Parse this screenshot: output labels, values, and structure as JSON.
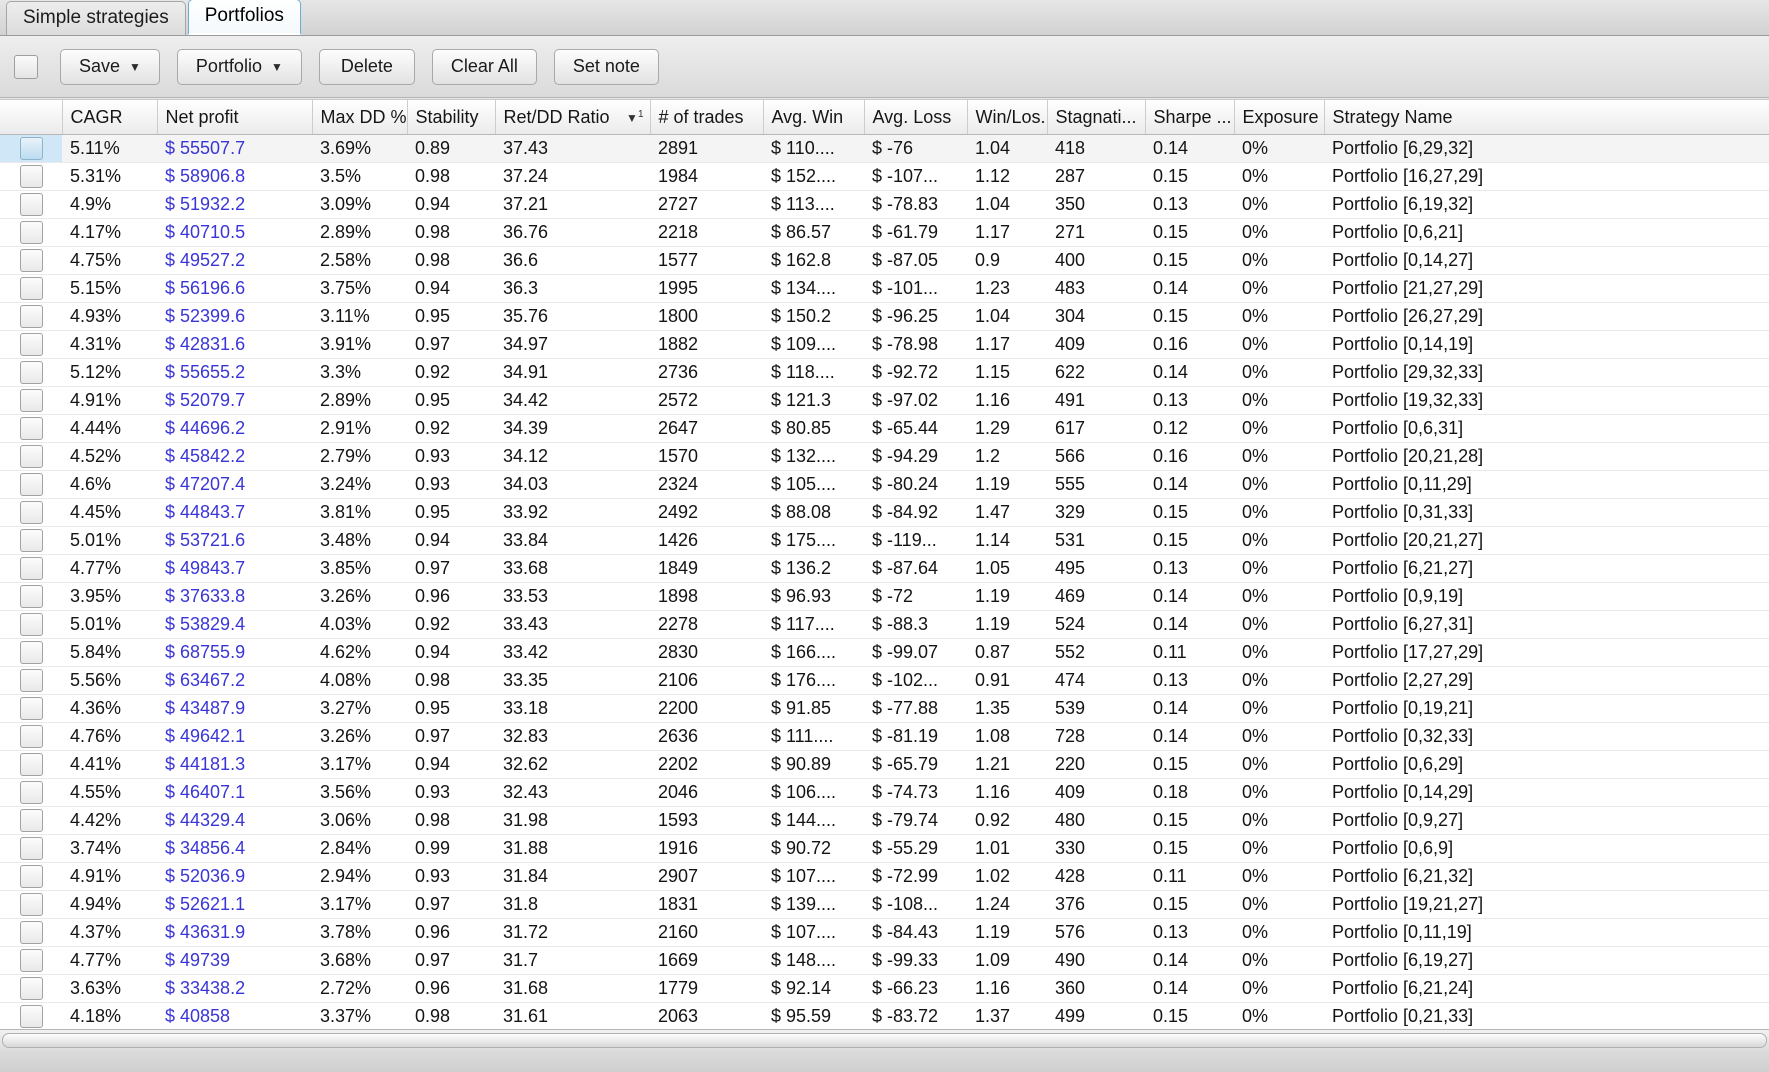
{
  "tabs": [
    {
      "label": "Simple strategies",
      "active": false
    },
    {
      "label": "Portfolios",
      "active": true
    }
  ],
  "toolbar": {
    "select_all_checkbox": "",
    "buttons": [
      {
        "label": "Save",
        "caret": "▼"
      },
      {
        "label": "Portfolio",
        "caret": "▼"
      },
      {
        "label": "Delete",
        "caret": ""
      },
      {
        "label": "Clear All",
        "caret": ""
      },
      {
        "label": "Set note",
        "caret": ""
      }
    ]
  },
  "table": {
    "sort": {
      "column": "Ret/DD Ratio",
      "direction": "▼",
      "priority": "1"
    },
    "columns": [
      {
        "key": "checkbox",
        "label": ""
      },
      {
        "key": "cagr",
        "label": "CAGR"
      },
      {
        "key": "net",
        "label": "Net profit"
      },
      {
        "key": "maxdd",
        "label": "Max DD %"
      },
      {
        "key": "stability",
        "label": "Stability"
      },
      {
        "key": "retdd",
        "label": "Ret/DD Ratio"
      },
      {
        "key": "trades",
        "label": "# of trades"
      },
      {
        "key": "avgwin",
        "label": "Avg. Win"
      },
      {
        "key": "avgloss",
        "label": "Avg. Loss"
      },
      {
        "key": "winloss",
        "label": "Win/Los..."
      },
      {
        "key": "stagnation",
        "label": "Stagnati..."
      },
      {
        "key": "sharpe",
        "label": "Sharpe ..."
      },
      {
        "key": "exposure",
        "label": "Exposure"
      },
      {
        "key": "name",
        "label": "Strategy Name"
      }
    ],
    "rows": [
      {
        "selected": true,
        "cagr": "5.11%",
        "net": "$ 55507.7",
        "maxdd": "3.69%",
        "stability": "0.89",
        "retdd": "37.43",
        "trades": "2891",
        "avgwin": "$ 110....",
        "avgloss": "$ -76",
        "winloss": "1.04",
        "stagnation": "418",
        "sharpe": "0.14",
        "exposure": "0%",
        "name": "Portfolio [6,29,32]"
      },
      {
        "selected": false,
        "cagr": "5.31%",
        "net": "$ 58906.8",
        "maxdd": "3.5%",
        "stability": "0.98",
        "retdd": "37.24",
        "trades": "1984",
        "avgwin": "$ 152....",
        "avgloss": "$ -107...",
        "winloss": "1.12",
        "stagnation": "287",
        "sharpe": "0.15",
        "exposure": "0%",
        "name": "Portfolio [16,27,29]"
      },
      {
        "selected": false,
        "cagr": "4.9%",
        "net": "$ 51932.2",
        "maxdd": "3.09%",
        "stability": "0.94",
        "retdd": "37.21",
        "trades": "2727",
        "avgwin": "$ 113....",
        "avgloss": "$ -78.83",
        "winloss": "1.04",
        "stagnation": "350",
        "sharpe": "0.13",
        "exposure": "0%",
        "name": "Portfolio [6,19,32]"
      },
      {
        "selected": false,
        "cagr": "4.17%",
        "net": "$ 40710.5",
        "maxdd": "2.89%",
        "stability": "0.98",
        "retdd": "36.76",
        "trades": "2218",
        "avgwin": "$ 86.57",
        "avgloss": "$ -61.79",
        "winloss": "1.17",
        "stagnation": "271",
        "sharpe": "0.15",
        "exposure": "0%",
        "name": "Portfolio [0,6,21]"
      },
      {
        "selected": false,
        "cagr": "4.75%",
        "net": "$ 49527.2",
        "maxdd": "2.58%",
        "stability": "0.98",
        "retdd": "36.6",
        "trades": "1577",
        "avgwin": "$ 162.8",
        "avgloss": "$ -87.05",
        "winloss": "0.9",
        "stagnation": "400",
        "sharpe": "0.15",
        "exposure": "0%",
        "name": "Portfolio [0,14,27]"
      },
      {
        "selected": false,
        "cagr": "5.15%",
        "net": "$ 56196.6",
        "maxdd": "3.75%",
        "stability": "0.94",
        "retdd": "36.3",
        "trades": "1995",
        "avgwin": "$ 134....",
        "avgloss": "$ -101...",
        "winloss": "1.23",
        "stagnation": "483",
        "sharpe": "0.14",
        "exposure": "0%",
        "name": "Portfolio [21,27,29]"
      },
      {
        "selected": false,
        "cagr": "4.93%",
        "net": "$ 52399.6",
        "maxdd": "3.11%",
        "stability": "0.95",
        "retdd": "35.76",
        "trades": "1800",
        "avgwin": "$ 150.2",
        "avgloss": "$ -96.25",
        "winloss": "1.04",
        "stagnation": "304",
        "sharpe": "0.15",
        "exposure": "0%",
        "name": "Portfolio [26,27,29]"
      },
      {
        "selected": false,
        "cagr": "4.31%",
        "net": "$ 42831.6",
        "maxdd": "3.91%",
        "stability": "0.97",
        "retdd": "34.97",
        "trades": "1882",
        "avgwin": "$ 109....",
        "avgloss": "$ -78.98",
        "winloss": "1.17",
        "stagnation": "409",
        "sharpe": "0.16",
        "exposure": "0%",
        "name": "Portfolio [0,14,19]"
      },
      {
        "selected": false,
        "cagr": "5.12%",
        "net": "$ 55655.2",
        "maxdd": "3.3%",
        "stability": "0.92",
        "retdd": "34.91",
        "trades": "2736",
        "avgwin": "$ 118....",
        "avgloss": "$ -92.72",
        "winloss": "1.15",
        "stagnation": "622",
        "sharpe": "0.14",
        "exposure": "0%",
        "name": "Portfolio [29,32,33]"
      },
      {
        "selected": false,
        "cagr": "4.91%",
        "net": "$ 52079.7",
        "maxdd": "2.89%",
        "stability": "0.95",
        "retdd": "34.42",
        "trades": "2572",
        "avgwin": "$ 121.3",
        "avgloss": "$ -97.02",
        "winloss": "1.16",
        "stagnation": "491",
        "sharpe": "0.13",
        "exposure": "0%",
        "name": "Portfolio [19,32,33]"
      },
      {
        "selected": false,
        "cagr": "4.44%",
        "net": "$ 44696.2",
        "maxdd": "2.91%",
        "stability": "0.92",
        "retdd": "34.39",
        "trades": "2647",
        "avgwin": "$ 80.85",
        "avgloss": "$ -65.44",
        "winloss": "1.29",
        "stagnation": "617",
        "sharpe": "0.12",
        "exposure": "0%",
        "name": "Portfolio [0,6,31]"
      },
      {
        "selected": false,
        "cagr": "4.52%",
        "net": "$ 45842.2",
        "maxdd": "2.79%",
        "stability": "0.93",
        "retdd": "34.12",
        "trades": "1570",
        "avgwin": "$ 132....",
        "avgloss": "$ -94.29",
        "winloss": "1.2",
        "stagnation": "566",
        "sharpe": "0.16",
        "exposure": "0%",
        "name": "Portfolio [20,21,28]"
      },
      {
        "selected": false,
        "cagr": "4.6%",
        "net": "$ 47207.4",
        "maxdd": "3.24%",
        "stability": "0.93",
        "retdd": "34.03",
        "trades": "2324",
        "avgwin": "$ 105....",
        "avgloss": "$ -80.24",
        "winloss": "1.19",
        "stagnation": "555",
        "sharpe": "0.14",
        "exposure": "0%",
        "name": "Portfolio [0,11,29]"
      },
      {
        "selected": false,
        "cagr": "4.45%",
        "net": "$ 44843.7",
        "maxdd": "3.81%",
        "stability": "0.95",
        "retdd": "33.92",
        "trades": "2492",
        "avgwin": "$ 88.08",
        "avgloss": "$ -84.92",
        "winloss": "1.47",
        "stagnation": "329",
        "sharpe": "0.15",
        "exposure": "0%",
        "name": "Portfolio [0,31,33]"
      },
      {
        "selected": false,
        "cagr": "5.01%",
        "net": "$ 53721.6",
        "maxdd": "3.48%",
        "stability": "0.94",
        "retdd": "33.84",
        "trades": "1426",
        "avgwin": "$ 175....",
        "avgloss": "$ -119...",
        "winloss": "1.14",
        "stagnation": "531",
        "sharpe": "0.15",
        "exposure": "0%",
        "name": "Portfolio [20,21,27]"
      },
      {
        "selected": false,
        "cagr": "4.77%",
        "net": "$ 49843.7",
        "maxdd": "3.85%",
        "stability": "0.97",
        "retdd": "33.68",
        "trades": "1849",
        "avgwin": "$ 136.2",
        "avgloss": "$ -87.64",
        "winloss": "1.05",
        "stagnation": "495",
        "sharpe": "0.13",
        "exposure": "0%",
        "name": "Portfolio [6,21,27]"
      },
      {
        "selected": false,
        "cagr": "3.95%",
        "net": "$ 37633.8",
        "maxdd": "3.26%",
        "stability": "0.96",
        "retdd": "33.53",
        "trades": "1898",
        "avgwin": "$ 96.93",
        "avgloss": "$ -72",
        "winloss": "1.19",
        "stagnation": "469",
        "sharpe": "0.14",
        "exposure": "0%",
        "name": "Portfolio [0,9,19]"
      },
      {
        "selected": false,
        "cagr": "5.01%",
        "net": "$ 53829.4",
        "maxdd": "4.03%",
        "stability": "0.92",
        "retdd": "33.43",
        "trades": "2278",
        "avgwin": "$ 117....",
        "avgloss": "$ -88.3",
        "winloss": "1.19",
        "stagnation": "524",
        "sharpe": "0.14",
        "exposure": "0%",
        "name": "Portfolio [6,27,31]"
      },
      {
        "selected": false,
        "cagr": "5.84%",
        "net": "$ 68755.9",
        "maxdd": "4.62%",
        "stability": "0.94",
        "retdd": "33.42",
        "trades": "2830",
        "avgwin": "$ 166....",
        "avgloss": "$ -99.07",
        "winloss": "0.87",
        "stagnation": "552",
        "sharpe": "0.11",
        "exposure": "0%",
        "name": "Portfolio [17,27,29]"
      },
      {
        "selected": false,
        "cagr": "5.56%",
        "net": "$ 63467.2",
        "maxdd": "4.08%",
        "stability": "0.98",
        "retdd": "33.35",
        "trades": "2106",
        "avgwin": "$ 176....",
        "avgloss": "$ -102...",
        "winloss": "0.91",
        "stagnation": "474",
        "sharpe": "0.13",
        "exposure": "0%",
        "name": "Portfolio [2,27,29]"
      },
      {
        "selected": false,
        "cagr": "4.36%",
        "net": "$ 43487.9",
        "maxdd": "3.27%",
        "stability": "0.95",
        "retdd": "33.18",
        "trades": "2200",
        "avgwin": "$ 91.85",
        "avgloss": "$ -77.88",
        "winloss": "1.35",
        "stagnation": "539",
        "sharpe": "0.14",
        "exposure": "0%",
        "name": "Portfolio [0,19,21]"
      },
      {
        "selected": false,
        "cagr": "4.76%",
        "net": "$ 49642.1",
        "maxdd": "3.26%",
        "stability": "0.97",
        "retdd": "32.83",
        "trades": "2636",
        "avgwin": "$ 111....",
        "avgloss": "$ -81.19",
        "winloss": "1.08",
        "stagnation": "728",
        "sharpe": "0.14",
        "exposure": "0%",
        "name": "Portfolio [0,32,33]"
      },
      {
        "selected": false,
        "cagr": "4.41%",
        "net": "$ 44181.3",
        "maxdd": "3.17%",
        "stability": "0.94",
        "retdd": "32.62",
        "trades": "2202",
        "avgwin": "$ 90.89",
        "avgloss": "$ -65.79",
        "winloss": "1.21",
        "stagnation": "220",
        "sharpe": "0.15",
        "exposure": "0%",
        "name": "Portfolio [0,6,29]"
      },
      {
        "selected": false,
        "cagr": "4.55%",
        "net": "$ 46407.1",
        "maxdd": "3.56%",
        "stability": "0.93",
        "retdd": "32.43",
        "trades": "2046",
        "avgwin": "$ 106....",
        "avgloss": "$ -74.73",
        "winloss": "1.16",
        "stagnation": "409",
        "sharpe": "0.18",
        "exposure": "0%",
        "name": "Portfolio [0,14,29]"
      },
      {
        "selected": false,
        "cagr": "4.42%",
        "net": "$ 44329.4",
        "maxdd": "3.06%",
        "stability": "0.98",
        "retdd": "31.98",
        "trades": "1593",
        "avgwin": "$ 144....",
        "avgloss": "$ -79.74",
        "winloss": "0.92",
        "stagnation": "480",
        "sharpe": "0.15",
        "exposure": "0%",
        "name": "Portfolio [0,9,27]"
      },
      {
        "selected": false,
        "cagr": "3.74%",
        "net": "$ 34856.4",
        "maxdd": "2.84%",
        "stability": "0.99",
        "retdd": "31.88",
        "trades": "1916",
        "avgwin": "$ 90.72",
        "avgloss": "$ -55.29",
        "winloss": "1.01",
        "stagnation": "330",
        "sharpe": "0.15",
        "exposure": "0%",
        "name": "Portfolio [0,6,9]"
      },
      {
        "selected": false,
        "cagr": "4.91%",
        "net": "$ 52036.9",
        "maxdd": "2.94%",
        "stability": "0.93",
        "retdd": "31.84",
        "trades": "2907",
        "avgwin": "$ 107....",
        "avgloss": "$ -72.99",
        "winloss": "1.02",
        "stagnation": "428",
        "sharpe": "0.11",
        "exposure": "0%",
        "name": "Portfolio [6,21,32]"
      },
      {
        "selected": false,
        "cagr": "4.94%",
        "net": "$ 52621.1",
        "maxdd": "3.17%",
        "stability": "0.97",
        "retdd": "31.8",
        "trades": "1831",
        "avgwin": "$ 139....",
        "avgloss": "$ -108...",
        "winloss": "1.24",
        "stagnation": "376",
        "sharpe": "0.15",
        "exposure": "0%",
        "name": "Portfolio [19,21,27]"
      },
      {
        "selected": false,
        "cagr": "4.37%",
        "net": "$ 43631.9",
        "maxdd": "3.78%",
        "stability": "0.96",
        "retdd": "31.72",
        "trades": "2160",
        "avgwin": "$ 107....",
        "avgloss": "$ -84.43",
        "winloss": "1.19",
        "stagnation": "576",
        "sharpe": "0.13",
        "exposure": "0%",
        "name": "Portfolio [0,11,19]"
      },
      {
        "selected": false,
        "cagr": "4.77%",
        "net": "$ 49739",
        "maxdd": "3.68%",
        "stability": "0.97",
        "retdd": "31.7",
        "trades": "1669",
        "avgwin": "$ 148....",
        "avgloss": "$ -99.33",
        "winloss": "1.09",
        "stagnation": "490",
        "sharpe": "0.14",
        "exposure": "0%",
        "name": "Portfolio [6,19,27]"
      },
      {
        "selected": false,
        "cagr": "3.63%",
        "net": "$ 33438.2",
        "maxdd": "2.72%",
        "stability": "0.96",
        "retdd": "31.68",
        "trades": "1779",
        "avgwin": "$ 92.14",
        "avgloss": "$ -66.23",
        "winloss": "1.16",
        "stagnation": "360",
        "sharpe": "0.14",
        "exposure": "0%",
        "name": "Portfolio [6,21,24]"
      },
      {
        "selected": false,
        "cagr": "4.18%",
        "net": "$ 40858",
        "maxdd": "3.37%",
        "stability": "0.98",
        "retdd": "31.61",
        "trades": "2063",
        "avgwin": "$ 95.59",
        "avgloss": "$ -83.72",
        "winloss": "1.37",
        "stagnation": "499",
        "sharpe": "0.15",
        "exposure": "0%",
        "name": "Portfolio [0,21,33]"
      }
    ]
  },
  "colors": {
    "money_text": "#3a35d6",
    "selected_row_checkbox_bg": "#cfe7f7",
    "active_tab_border": "#6aaed6"
  }
}
